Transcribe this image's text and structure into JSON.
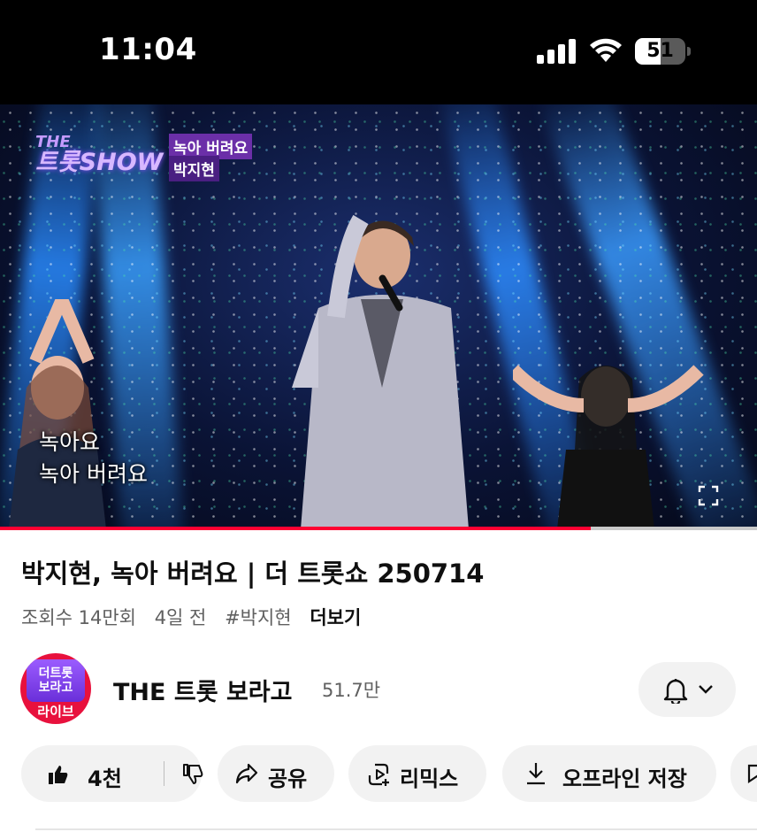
{
  "status_bar": {
    "time": "11:04",
    "battery_level": "51",
    "battery_fraction": 0.51
  },
  "video": {
    "show_logo_line1": "THE",
    "show_logo_line2": "트롯SHOW",
    "song_tag": "녹아 버려요",
    "singer_tag": "박지현",
    "lyric_line1": "녹아요",
    "lyric_line2": "녹아 버려요",
    "progress_fraction": 0.78,
    "progress_color": "#ff0033"
  },
  "info": {
    "title": "박지현, 녹아 버려요 | 더 트롯쇼 250714",
    "views": "조회수 14만회",
    "age": "4일 전",
    "hashtag": "#박지현",
    "more": "더보기"
  },
  "channel": {
    "avatar_text_line1": "더트롯",
    "avatar_text_line2": "보라고",
    "avatar_live": "라이브",
    "name": "THE 트롯 보라고",
    "subscribers": "51.7만"
  },
  "actions": {
    "like_count": "4천",
    "share": "공유",
    "remix": "리믹스",
    "download": "오프라인 저장"
  },
  "icons": [
    "signal-icon",
    "wifi-icon",
    "battery-icon",
    "fullscreen-icon",
    "bell-icon",
    "chevron-down-icon",
    "thumbs-up-icon",
    "thumbs-down-icon",
    "share-icon",
    "remix-icon",
    "download-icon",
    "save-icon"
  ]
}
